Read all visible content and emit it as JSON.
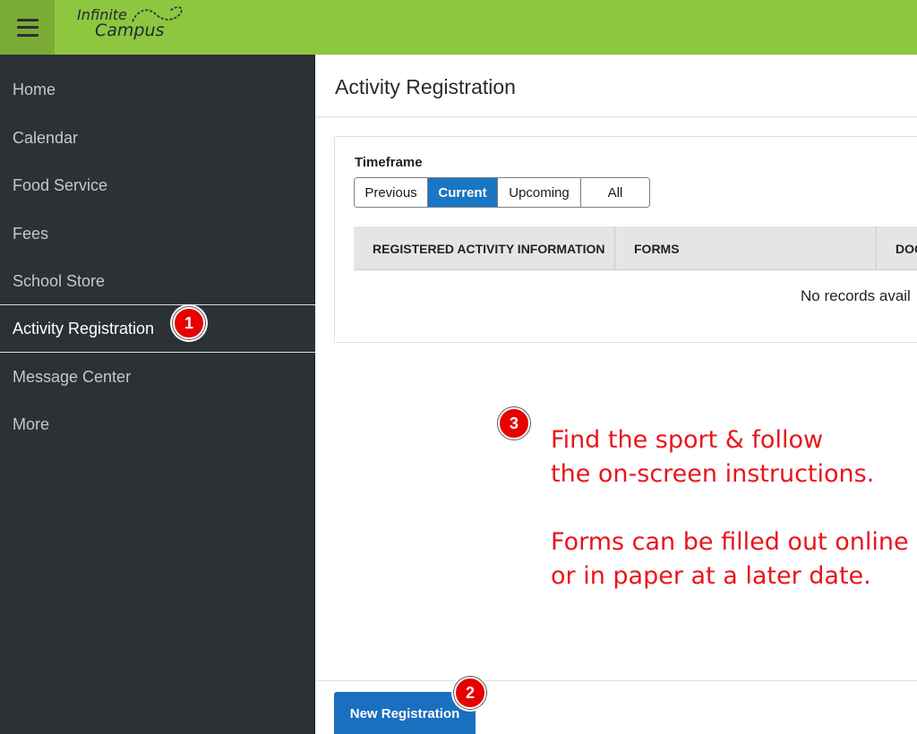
{
  "header": {
    "logo_line1": "Infinite",
    "logo_line2": "Campus",
    "brand_color": "#8dc63f"
  },
  "sidebar": {
    "items": [
      {
        "label": "Home"
      },
      {
        "label": "Calendar"
      },
      {
        "label": "Food Service"
      },
      {
        "label": "Fees"
      },
      {
        "label": "School Store"
      },
      {
        "label": "Activity Registration",
        "active": true
      },
      {
        "label": "Message Center"
      },
      {
        "label": "More"
      }
    ]
  },
  "page": {
    "title": "Activity Registration",
    "timeframe_label": "Timeframe",
    "timeframe_options": [
      "Previous",
      "Current",
      "Upcoming",
      "All"
    ],
    "timeframe_selected": "Current",
    "table_columns": [
      "REGISTERED ACTIVITY INFORMATION",
      "FORMS",
      "DOC"
    ],
    "empty_message": "No records avail",
    "new_registration_button": "New Registration",
    "accent_color": "#1976c2"
  },
  "annotations": {
    "badge1": "1",
    "badge2": "2",
    "badge3": "3",
    "line1": "Find the sport & follow",
    "line2": "the on-screen instructions.",
    "line3": "Forms can be filled out online",
    "line4": "or in paper at a later date.",
    "color": "#e8151b"
  }
}
